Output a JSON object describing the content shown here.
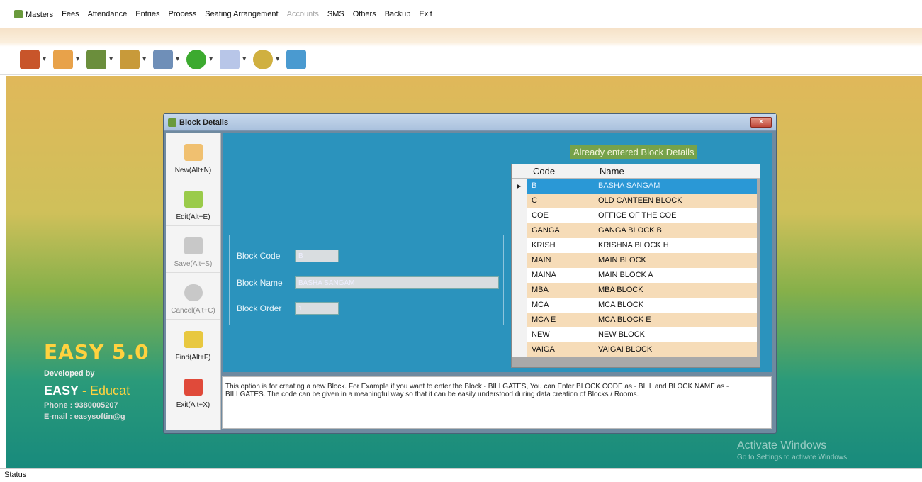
{
  "menubar": {
    "items": [
      "Masters",
      "Fees",
      "Attendance",
      "Entries",
      "Process",
      "Seating Arrangement",
      "Accounts",
      "SMS",
      "Others",
      "Backup",
      "Exit"
    ],
    "disabled": "Accounts"
  },
  "toolbar": {
    "icons": [
      "gift-icon",
      "users-icon",
      "people-icon",
      "coins-icon",
      "calendar-icon",
      "globe-icon",
      "notepad-icon",
      "settings-icon",
      "exit-door-icon"
    ],
    "colors": [
      "#c8552a",
      "#e8a24a",
      "#6b8e3c",
      "#c89a3a",
      "#6f8fb8",
      "#3caa2f",
      "#b8c6e8",
      "#d0b040",
      "#4a9ad0"
    ]
  },
  "brand": {
    "title": "EASY 5.0",
    "developed": "Developed by",
    "company_prefix": "EASY",
    "company_rest": " - Educat",
    "phone": "Phone : 9380005207",
    "email": "E-mail : easysoftin@g"
  },
  "window": {
    "title": "Block Details",
    "close": "✕"
  },
  "sidebar": {
    "new": "New(Alt+N)",
    "edit": "Edit(Alt+E)",
    "save": "Save(Alt+S)",
    "cancel": "Cancel(Alt+C)",
    "find": "Find(Alt+F)",
    "exit": "Exit(Alt+X)"
  },
  "form": {
    "code_label": "Block Code",
    "code_value": "B",
    "name_label": "Block Name",
    "name_value": "BASHA SANGAM",
    "order_label": "Block Order",
    "order_value": "1"
  },
  "grid": {
    "title": "Already entered Block Details",
    "headers": [
      "Code",
      "Name"
    ],
    "selected_index": 0,
    "rows": [
      [
        "B",
        "BASHA SANGAM"
      ],
      [
        "C",
        "OLD CANTEEN BLOCK"
      ],
      [
        "COE",
        "OFFICE OF THE COE"
      ],
      [
        "GANGA",
        "GANGA BLOCK B"
      ],
      [
        "KRISH",
        "KRISHNA BLOCK H"
      ],
      [
        "MAIN",
        "MAIN BLOCK"
      ],
      [
        "MAINA",
        "MAIN BLOCK A"
      ],
      [
        "MBA",
        "MBA BLOCK"
      ],
      [
        "MCA",
        "MCA BLOCK"
      ],
      [
        "MCA E",
        "MCA BLOCK E"
      ],
      [
        "NEW",
        "NEW BLOCK"
      ],
      [
        "VAIGA",
        "VAIGAI BLOCK"
      ]
    ]
  },
  "help": {
    "text": "This option is for creating a new Block. For Example if you want to enter the Block - BILLGATES,  You can Enter BLOCK CODE as - BILL and BLOCK NAME as - BILLGATES. The code can be given in a meaningful way so that it can be easily understood during data creation of Blocks / Rooms."
  },
  "watermark": {
    "line1": "Activate Windows",
    "line2": "Go to Settings to activate Windows."
  },
  "status": {
    "text": "Status"
  }
}
